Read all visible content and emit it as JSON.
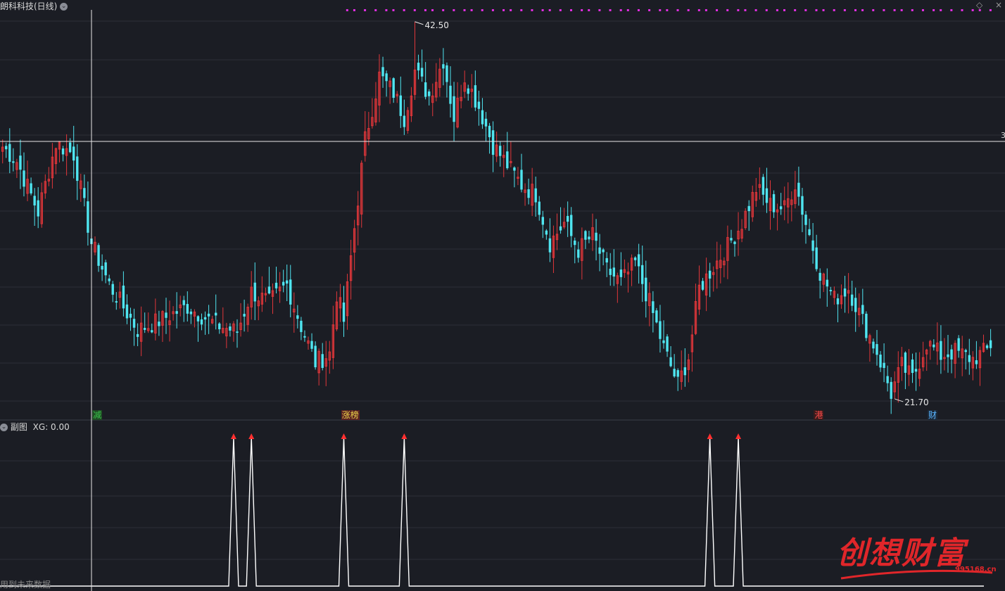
{
  "header": {
    "title": "朗科科技(日线)",
    "subchart_label": "副图",
    "indicator": "XG: 0.00",
    "price_edge_label": "3"
  },
  "markers": {
    "high_label": "42.50",
    "low_label": "21.70",
    "high_index": 116,
    "low_index": 251
  },
  "events": [
    {
      "text": "减",
      "index": 26,
      "color": "#39c24a",
      "bg": "#1f4a24"
    },
    {
      "text": "涨榜",
      "index": 96,
      "color": "#e8d24a",
      "bg": "#5a2222"
    },
    {
      "text": "港",
      "index": 229,
      "color": "#ff4b4b",
      "bg": "#3a1c1c"
    },
    {
      "text": "财",
      "index": 261,
      "color": "#5ab4ff",
      "bg": "#1c2a3a"
    }
  ],
  "colors": {
    "up": "#e0363a",
    "down": "#4fe5f0",
    "grid": "#2c3038",
    "crosshair": "#e8e8e8",
    "dots": "#e02ee0",
    "signal": "#ffffff",
    "signal_arrow": "#ff3030"
  },
  "chart_data": {
    "type": "candlestick",
    "ylim": [
      21.0,
      43.0
    ],
    "start_price": 35.5,
    "anchors": [
      [
        0,
        35.6
      ],
      [
        4,
        34.8
      ],
      [
        10,
        32.0
      ],
      [
        15,
        35.8
      ],
      [
        20,
        35.2
      ],
      [
        25,
        30.3
      ],
      [
        30,
        28.0
      ],
      [
        38,
        25.5
      ],
      [
        44,
        26.0
      ],
      [
        52,
        26.8
      ],
      [
        60,
        25.8
      ],
      [
        66,
        25.4
      ],
      [
        70,
        27.6
      ],
      [
        75,
        27.0
      ],
      [
        80,
        28.0
      ],
      [
        84,
        25.7
      ],
      [
        88,
        23.7
      ],
      [
        92,
        24.2
      ],
      [
        94,
        27.5
      ],
      [
        96,
        26.0
      ],
      [
        98,
        29.5
      ],
      [
        102,
        36.0
      ],
      [
        106,
        39.5
      ],
      [
        110,
        38.6
      ],
      [
        113,
        37.2
      ],
      [
        116,
        39.8
      ],
      [
        120,
        38.4
      ],
      [
        124,
        40.4
      ],
      [
        127,
        37.2
      ],
      [
        130,
        39.5
      ],
      [
        134,
        37.8
      ],
      [
        138,
        35.7
      ],
      [
        142,
        34.6
      ],
      [
        146,
        33.5
      ],
      [
        150,
        33.0
      ],
      [
        154,
        30.3
      ],
      [
        158,
        31.4
      ],
      [
        162,
        29.9
      ],
      [
        166,
        30.7
      ],
      [
        170,
        28.8
      ],
      [
        174,
        28.1
      ],
      [
        178,
        29.2
      ],
      [
        182,
        27.0
      ],
      [
        186,
        24.5
      ],
      [
        190,
        22.5
      ],
      [
        193,
        24.0
      ],
      [
        196,
        27.8
      ],
      [
        200,
        29.0
      ],
      [
        204,
        30.1
      ],
      [
        208,
        31.4
      ],
      [
        212,
        33.3
      ],
      [
        216,
        32.4
      ],
      [
        220,
        32.2
      ],
      [
        223,
        33.6
      ],
      [
        226,
        31.4
      ],
      [
        230,
        28.7
      ],
      [
        234,
        27.2
      ],
      [
        238,
        27.8
      ],
      [
        242,
        26.0
      ],
      [
        246,
        24.3
      ],
      [
        250,
        22.0
      ],
      [
        253,
        23.5
      ],
      [
        256,
        22.8
      ],
      [
        260,
        24.8
      ],
      [
        264,
        24.1
      ],
      [
        268,
        24.3
      ],
      [
        273,
        23.9
      ],
      [
        278,
        24.5
      ]
    ],
    "series": [
      {
        "name": "XG",
        "signal_indices": [
          65,
          70,
          96,
          113,
          199,
          207
        ]
      }
    ]
  }
}
